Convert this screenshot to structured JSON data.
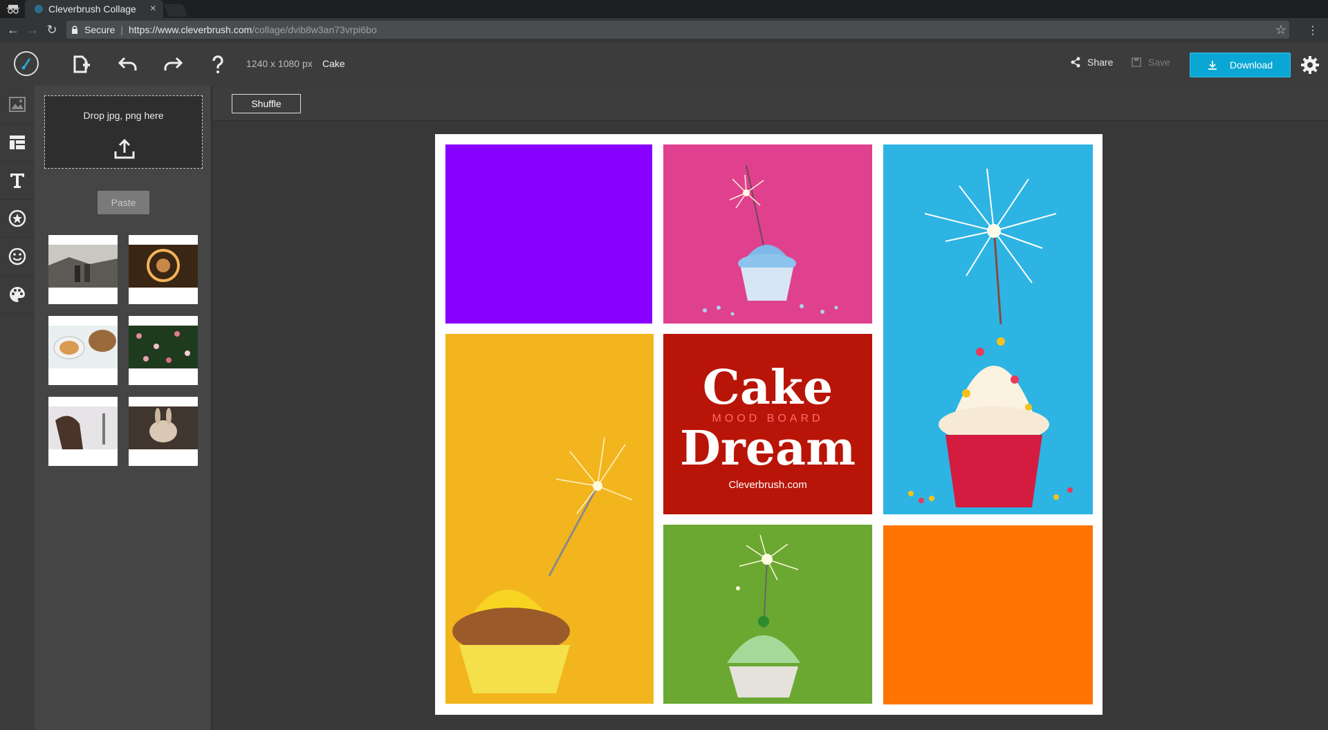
{
  "browser": {
    "tab_title": "Cleverbrush Collage",
    "tab_close": "×",
    "secure_label": "Secure",
    "url_separator": "|",
    "url_host": "https://www.cleverbrush.com",
    "url_path": "/collage/dvib8w3an73vrpi6bo",
    "star_glyph": "☆",
    "menu_glyph": "⋮",
    "back_glyph": "←",
    "forward_glyph": "→",
    "reload_glyph": "↻"
  },
  "appbar": {
    "dimensions": "1240 x 1080 px",
    "document_name": "Cake",
    "share_label": "Share",
    "save_label": "Save",
    "download_label": "Download"
  },
  "panel": {
    "drop_text": "Drop jpg, png here",
    "paste_label": "Paste",
    "thumbnails": [
      {
        "icon": "people-outdoors-thumbnail"
      },
      {
        "icon": "woman-lights-thumbnail"
      },
      {
        "icon": "food-table-thumbnail"
      },
      {
        "icon": "flowers-thumbnail"
      },
      {
        "icon": "woman-hair-thumbnail"
      },
      {
        "icon": "rabbit-thumbnail"
      }
    ]
  },
  "workspace": {
    "shuffle_label": "Shuffle"
  },
  "collage": {
    "title_line1": "Cake",
    "subtitle": "MOOD BOARD",
    "title_line2": "Dream",
    "website": "Cleverbrush.com",
    "colors": {
      "purple": "#8800ff",
      "pink": "#e0418f",
      "blue": "#2db4e3",
      "yellow": "#f2b51e",
      "red": "#b81508",
      "green": "#6aa832",
      "orange": "#ff7400"
    }
  },
  "colors": {
    "accent": "#0aa7d4",
    "background": "#383838"
  }
}
